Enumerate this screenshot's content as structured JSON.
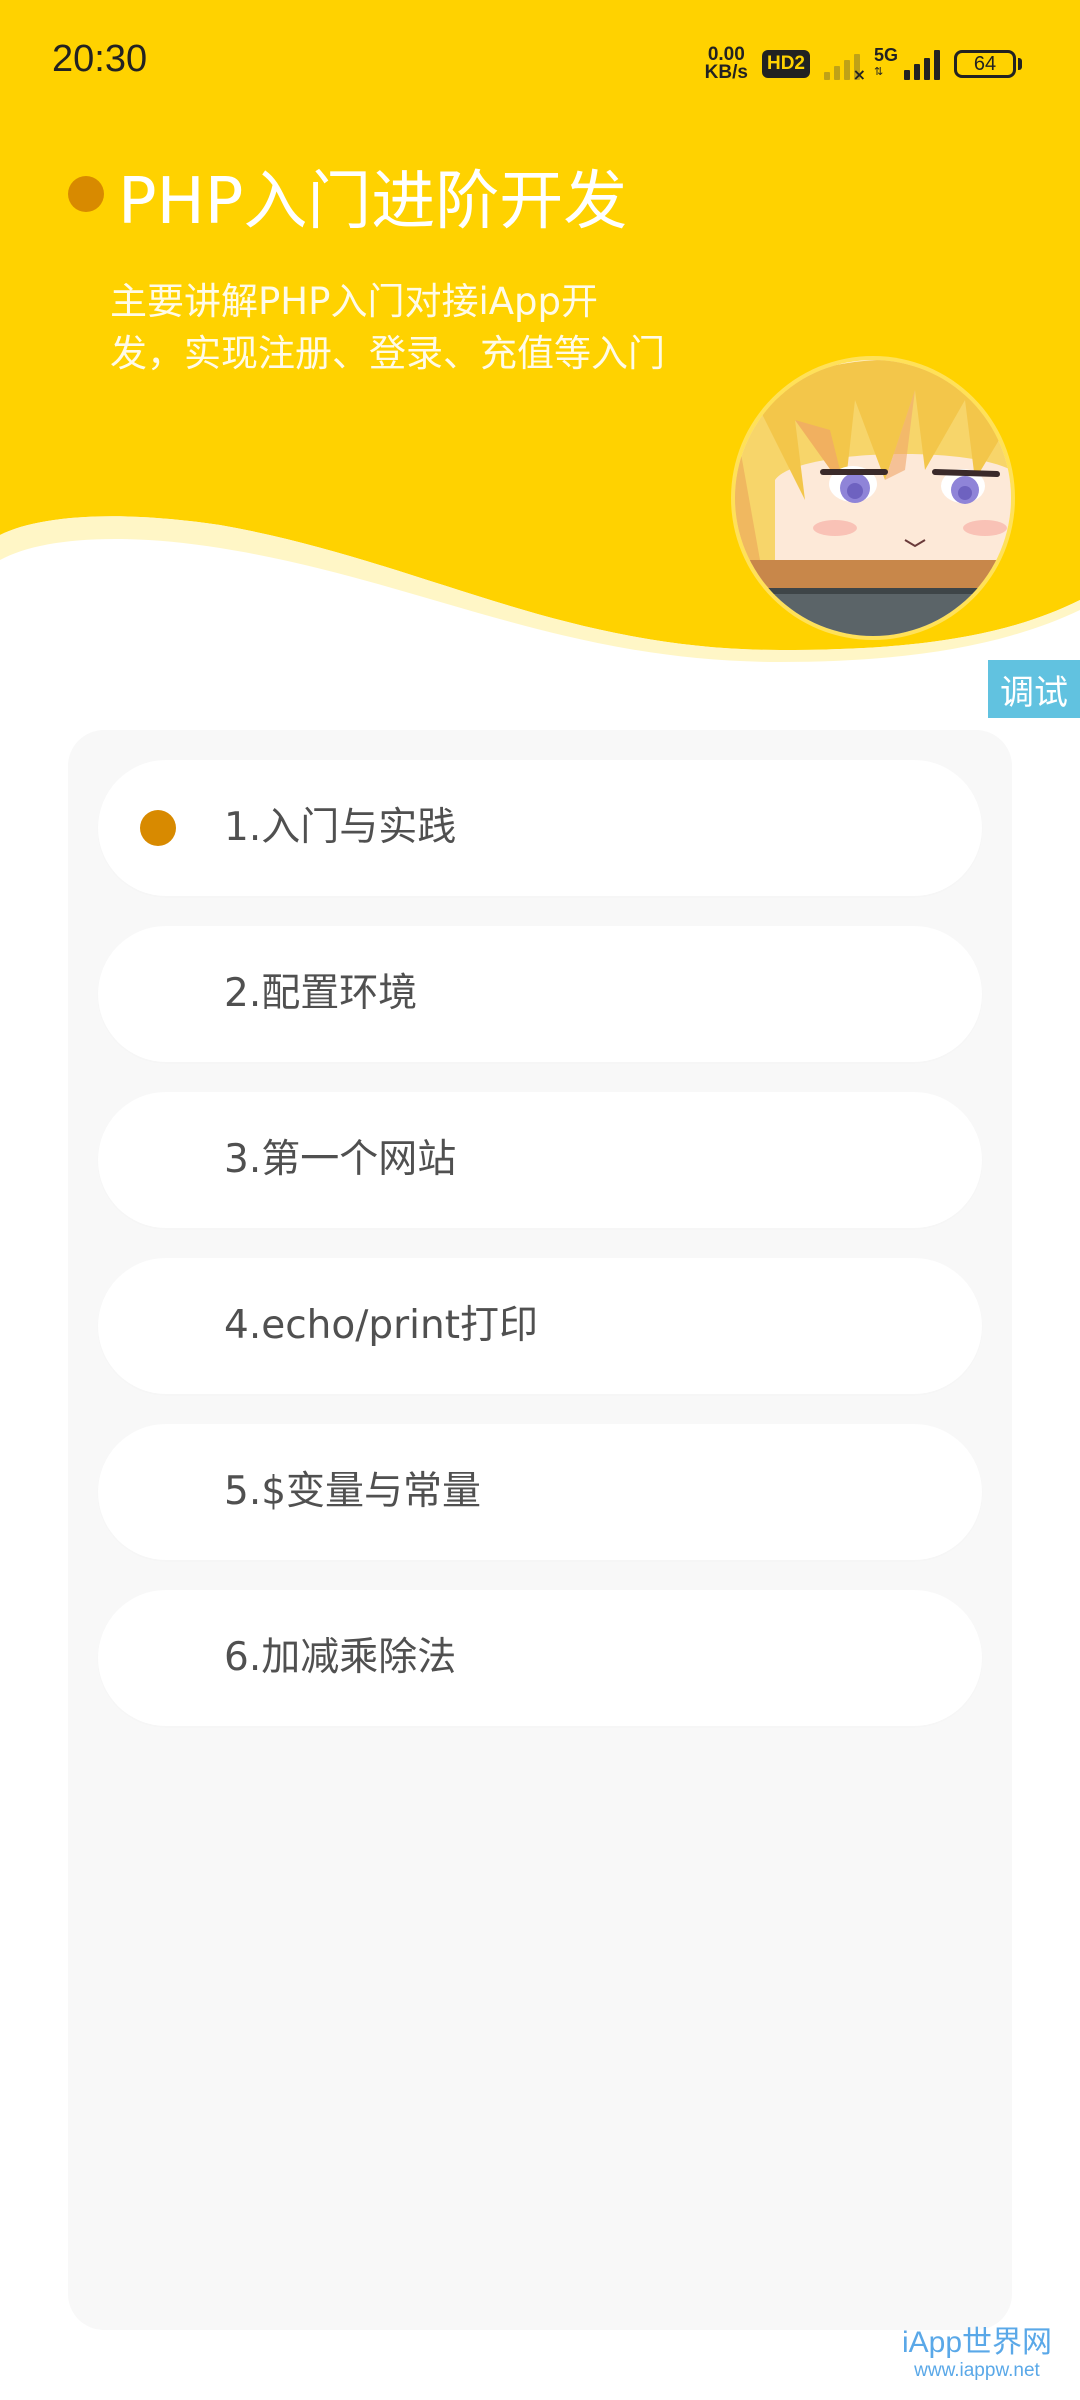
{
  "status_bar": {
    "time": "20:30",
    "net_speed_value": "0.00",
    "net_speed_unit": "KB/s",
    "hd_badge": "HD2",
    "network_type": "5G",
    "battery": "64"
  },
  "header": {
    "title": "PHP入门进阶开发",
    "subtitle_line1": "主要讲解PHP入门对接iApp开",
    "subtitle_line2": "发，实现注册、登录、充值等入门"
  },
  "debug_badge": "调试",
  "menu": {
    "items": [
      {
        "label": "1.入门与实践",
        "active": true
      },
      {
        "label": "2.配置环境",
        "active": false
      },
      {
        "label": "3.第一个网站",
        "active": false
      },
      {
        "label": "4.echo/print打印",
        "active": false
      },
      {
        "label": "5.$变量与常量",
        "active": false
      },
      {
        "label": "6.加减乘除法",
        "active": false
      }
    ]
  },
  "watermark": {
    "name": "iApp世界网",
    "url": "www.iappw.net"
  },
  "colors": {
    "header_yellow": "#ffd200",
    "accent_orange": "#d88a00",
    "debug_blue": "#61c2e0"
  }
}
